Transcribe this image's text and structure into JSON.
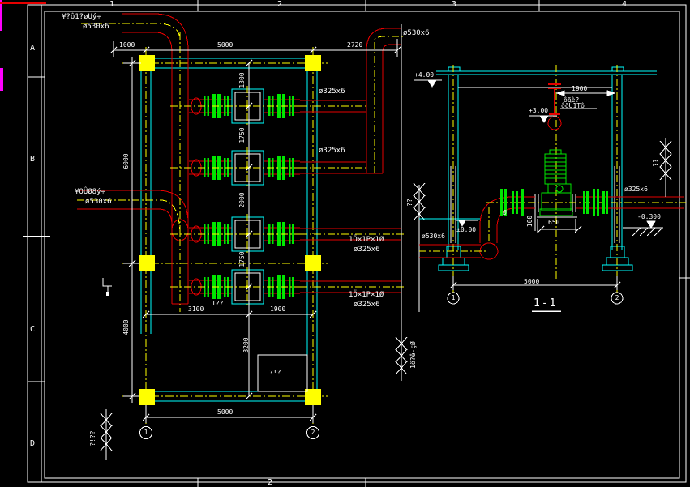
{
  "sheet": {
    "zone_numbers_top": [
      "1",
      "2",
      "3",
      "4"
    ],
    "zone_number_bottom": "2",
    "zone_letters_left": [
      "A",
      "B",
      "C",
      "D"
    ]
  },
  "plan": {
    "pipe_labels": {
      "top_left_line1": "¥?ô1?øUý÷",
      "top_left_line2": "ø530x6",
      "mid_left_line1": "¥QÛØ8ý÷",
      "mid_left_line2": "ø530x6",
      "top_right": "ø530x6",
      "branch_row1": "ø325x6",
      "branch_row2": "ø325x6",
      "discharge_row3_line1": "1Ö×1P×1Ø",
      "discharge_row3_line2": "ø325x6",
      "discharge_row4_line1": "1Ö×1P×1Ø",
      "discharge_row4_line2": "ø325x6"
    },
    "dimensions": {
      "top_left": "1000",
      "top_mid": "5000",
      "top_right": "2720",
      "row_gap_1": "1300",
      "row_gap_2": "1750",
      "row_gap_3": "2000",
      "row_gap_4": "1750",
      "below_rows": "3200",
      "low_left": "3100",
      "low_right": "1900",
      "left_upper": "6000",
      "left_lower": "4000",
      "bottom": "5000"
    },
    "grid_bubble_1": "1",
    "grid_bubble_2": "2",
    "sump_label": "?!?",
    "note_small": "1??",
    "break_note_right": "1ö?ê-çØ",
    "break_note_bottom_left": "?!??"
  },
  "section": {
    "title": "1-1",
    "elevations": {
      "roof": "+4.00",
      "hook": "+3.00",
      "floor": "±0.00",
      "ground": "-0.300"
    },
    "dimensions": {
      "hook_offset": "1900",
      "base_height": "100",
      "base_width": "650",
      "span": "5000"
    },
    "hoist_label_line1": "ôõè?",
    "hoist_label_line2": "ôõÜ1Tô",
    "pipe_label_right": "ø325x6",
    "pipe_label_left": "ø530x6",
    "phi_note": "Ø",
    "grid_bubble_1": "1",
    "grid_bubble_2": "2",
    "break_note_left": "??",
    "break_note_right": "??"
  },
  "colors": {
    "background": "#000000",
    "pipe_red": "#e60000",
    "valve_green": "#00e600",
    "structure_cyan": "#00ffff",
    "grid_yellow": "#ffff00",
    "line_white": "#ffffff",
    "artifact_magenta": "#ff00ff"
  }
}
